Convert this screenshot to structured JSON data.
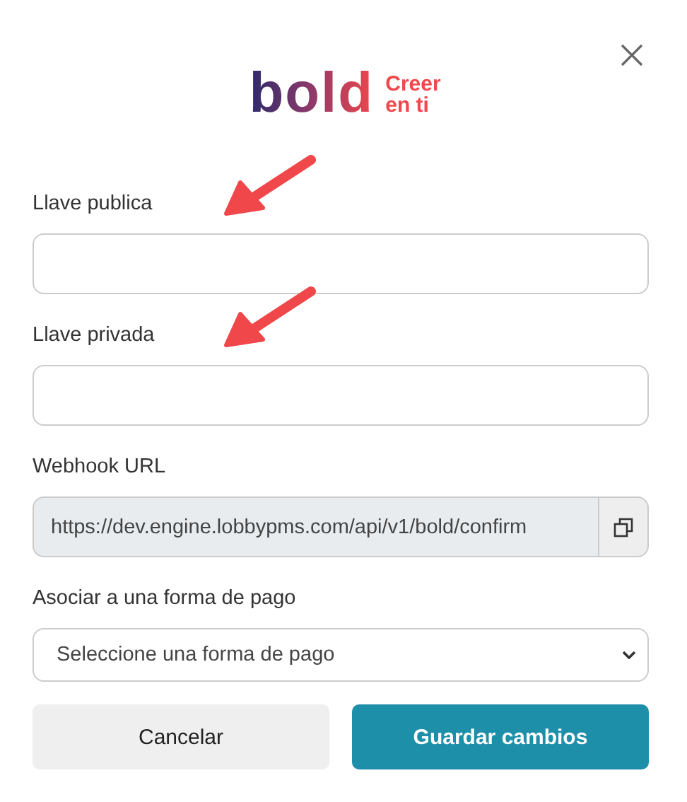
{
  "logo": {
    "wordmark": "bold",
    "tagline": [
      "Creer",
      "en ti"
    ]
  },
  "fields": [
    {
      "kind": "text",
      "label": "Llave publica",
      "annotated": true
    },
    {
      "kind": "text",
      "label": "Llave privada",
      "annotated": true
    },
    {
      "kind": "copy",
      "label": "Webhook URL",
      "value": "https://dev.engine.lobbypms.com/api/v1/bold/confirm"
    },
    {
      "kind": "select",
      "label": "Asociar a una forma de pago",
      "value": "Seleccione una forma de pago"
    }
  ],
  "buttons": [
    {
      "label": "Cancelar",
      "kind": "secondary"
    },
    {
      "label": "Guardar cambios",
      "kind": "primary"
    }
  ]
}
